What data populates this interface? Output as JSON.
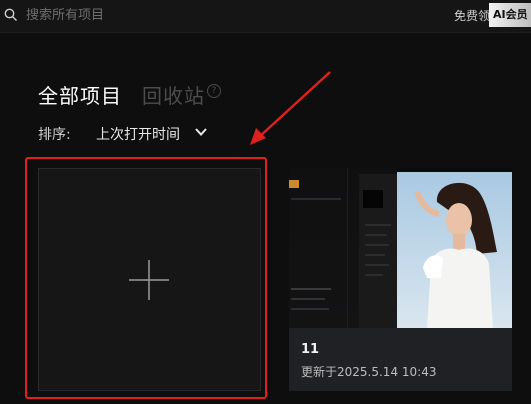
{
  "topbar": {
    "search_placeholder": "搜索所有项目",
    "promo_text": "免费领",
    "promo_badge": "AI会员"
  },
  "tabs": [
    {
      "label": "全部项目",
      "active": true
    },
    {
      "label": "回收站",
      "active": false
    }
  ],
  "help_icon_label": "?",
  "sort": {
    "label": "排序:",
    "value": "上次打开时间"
  },
  "projects": [
    {
      "name": "11",
      "updated": "更新于2025.5.14 10:43"
    }
  ],
  "colors": {
    "background": "#0e0e0f",
    "highlight": "#e0201c",
    "card": "#202124"
  }
}
